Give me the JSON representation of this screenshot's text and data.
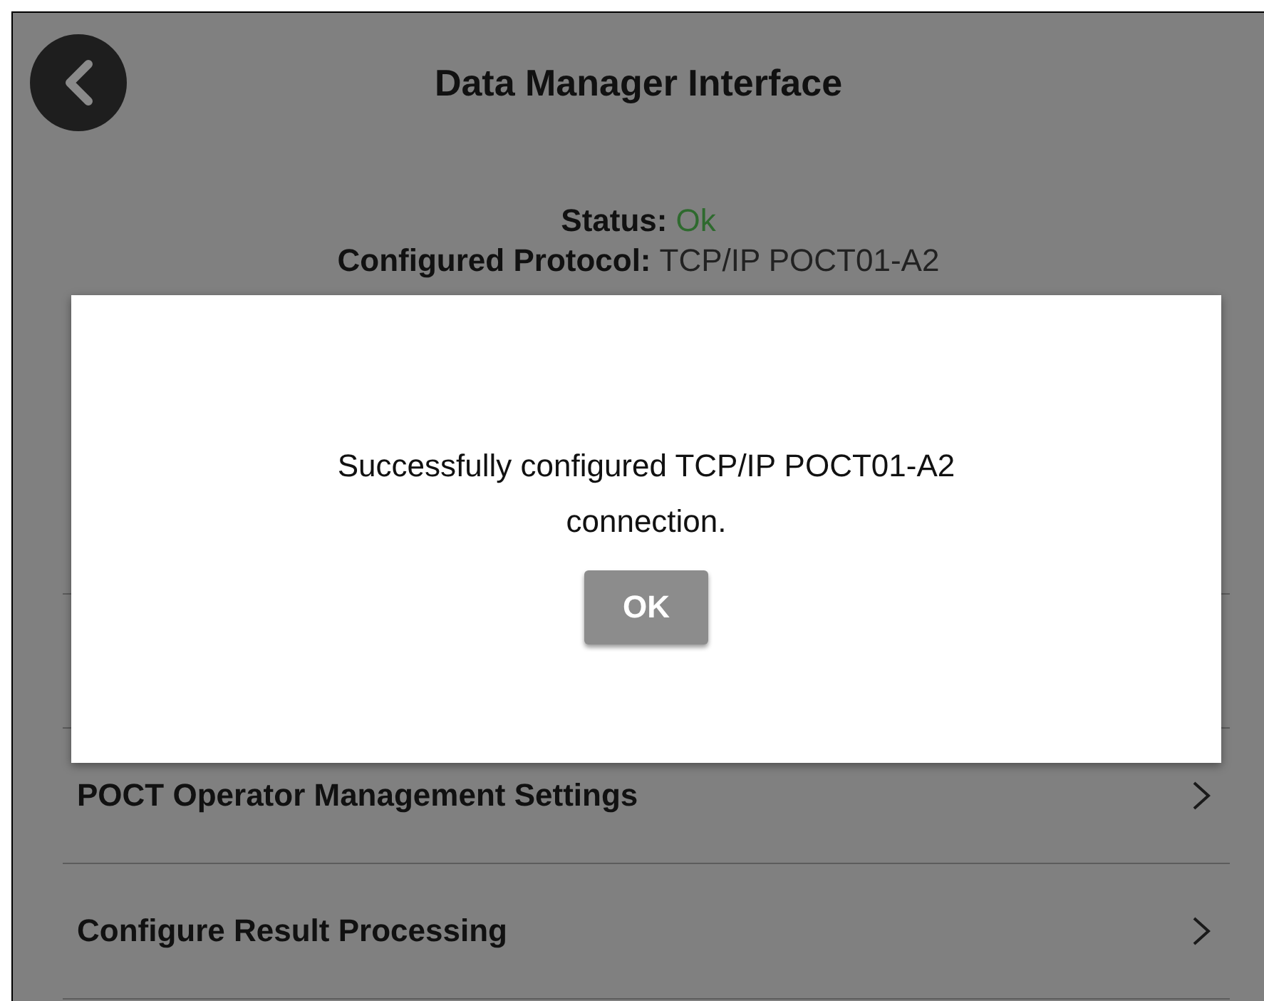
{
  "header": {
    "title": "Data Manager Interface"
  },
  "status": {
    "label": "Status:",
    "value": "Ok"
  },
  "protocol": {
    "label": "Configured Protocol:",
    "value": "TCP/IP POCT01-A2"
  },
  "menu_items": [
    {
      "label": "POCT Operator Management Settings"
    },
    {
      "label": "Configure Result Processing"
    }
  ],
  "dialog": {
    "message": "Successfully configured TCP/IP POCT01-A2 connection.",
    "button": "OK"
  }
}
